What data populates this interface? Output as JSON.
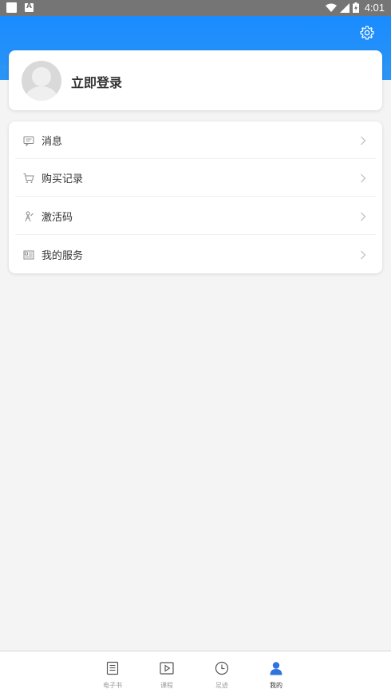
{
  "status_bar": {
    "time": "4:01"
  },
  "colors": {
    "header": "#1a8cff",
    "accent": "#2f73e0",
    "background": "#f4f4f4"
  },
  "header": {
    "settings_icon": "gear-icon"
  },
  "login": {
    "label": "立即登录",
    "avatar_icon": "default-avatar-icon"
  },
  "menu": {
    "items": [
      {
        "label": "消息",
        "icon": "message-icon"
      },
      {
        "label": "购买记录",
        "icon": "cart-icon"
      },
      {
        "label": "激活码",
        "icon": "activation-icon"
      },
      {
        "label": "我的服务",
        "icon": "service-icon"
      }
    ]
  },
  "tabbar": {
    "tabs": [
      {
        "label": "电子书",
        "icon": "ebook-icon",
        "active": false
      },
      {
        "label": "课程",
        "icon": "course-play-icon",
        "active": false
      },
      {
        "label": "足迹",
        "icon": "clock-icon",
        "active": false
      },
      {
        "label": "我的",
        "icon": "user-icon",
        "active": true
      }
    ]
  }
}
